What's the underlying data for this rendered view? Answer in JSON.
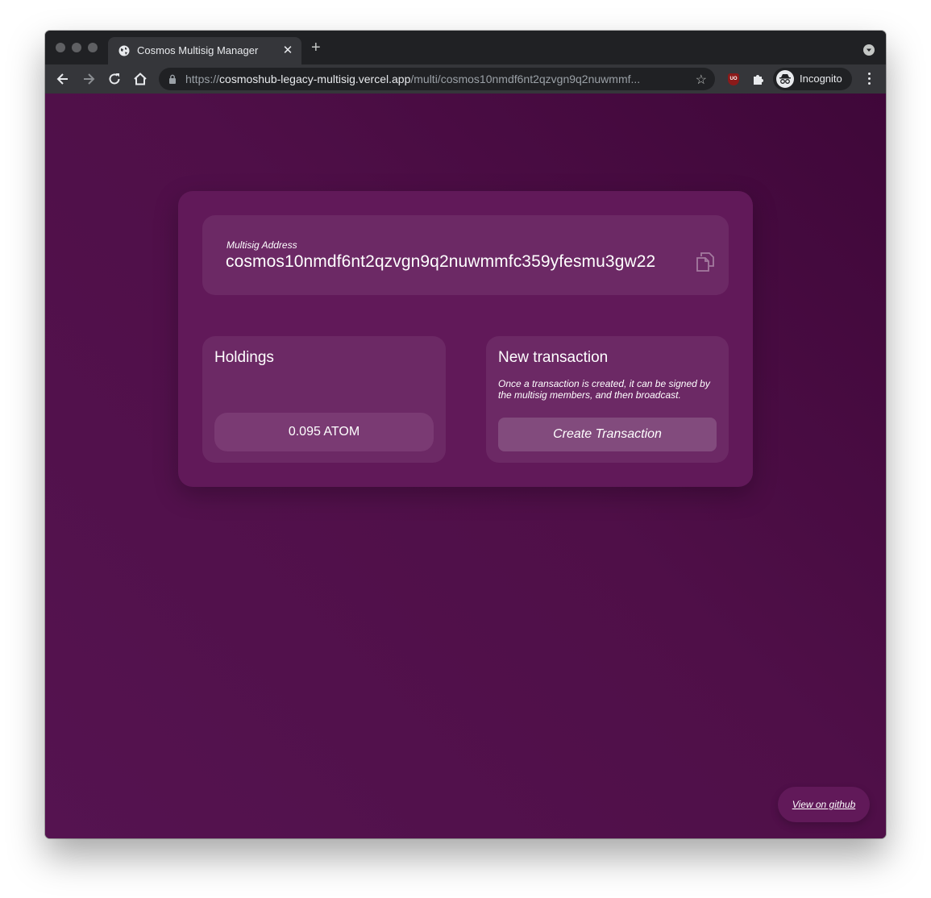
{
  "browser": {
    "tab_title": "Cosmos Multisig Manager",
    "tab_close": "✕",
    "new_tab": "+",
    "url_scheme": "https://",
    "url_host": "cosmoshub-legacy-multisig.vercel.app",
    "url_path": "/multi/cosmos10nmdf6nt2qzvgn9q2nuwmmf...",
    "bookmark_star": "☆",
    "extension_badge": "UO",
    "profile_label": "Incognito"
  },
  "address": {
    "label": "Multisig Address",
    "value": "cosmos10nmdf6nt2qzvgn9q2nuwmmfc359yfesmu3gw22"
  },
  "holdings": {
    "title": "Holdings",
    "balance": "0.095 ATOM"
  },
  "new_transaction": {
    "title": "New transaction",
    "description": "Once a transaction is created, it can be signed by the multisig members, and then broadcast.",
    "button_label": "Create Transaction"
  },
  "footer": {
    "github_link": "View on github"
  },
  "colors": {
    "background": "#4f0f48",
    "card": "#611959",
    "panel": "#6c2965",
    "button": "#824b7d"
  }
}
